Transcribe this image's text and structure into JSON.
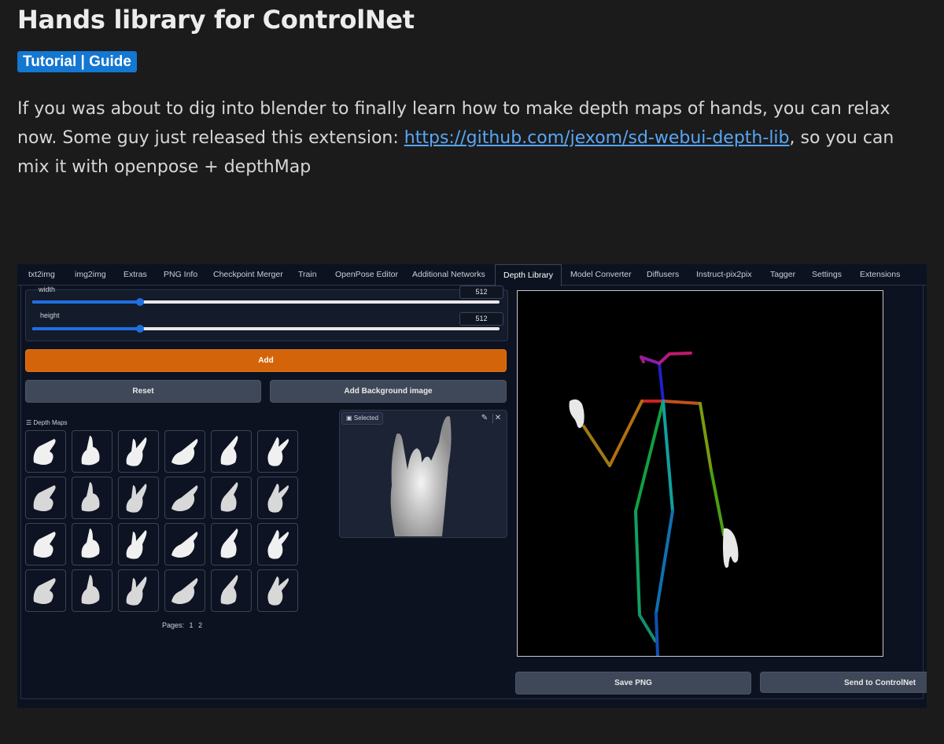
{
  "post": {
    "title": "Hands library for ControlNet",
    "tag": "Tutorial | Guide",
    "body_before": "If you was about to dig into blender to finally learn how to make depth maps of hands, you can relax now. Some guy just released this extension: ",
    "link": "https://github.com/jexom/sd-webui-depth-lib",
    "body_after": ", so you can mix it with openpose + depthMap"
  },
  "app": {
    "tabs": [
      "txt2img",
      "img2img",
      "Extras",
      "PNG Info",
      "Checkpoint Merger",
      "Train",
      "OpenPose Editor",
      "Additional Networks",
      "Depth Library",
      "Model Converter",
      "Diffusers",
      "Instruct-pix2pix",
      "Tagger",
      "Settings",
      "Extensions"
    ],
    "active_tab": "Depth Library",
    "width": {
      "label": "width",
      "value": "512",
      "fraction": 0.23
    },
    "height": {
      "label": "height",
      "value": "512",
      "fraction": 0.23
    },
    "add_label": "Add",
    "reset_label": "Reset",
    "add_background_label": "Add Background image",
    "depth_maps_label": "Depth Maps",
    "pages_label": "Pages:",
    "pages": [
      "1",
      "2"
    ],
    "selected_label": "Selected",
    "save_png_label": "Save PNG",
    "send_label": "Send to ControlNet"
  },
  "colors": {
    "accent_blue": "#1477d1",
    "link": "#58a6f5",
    "add_orange": "#d4640a",
    "slider_blue": "#1e6fe0"
  }
}
